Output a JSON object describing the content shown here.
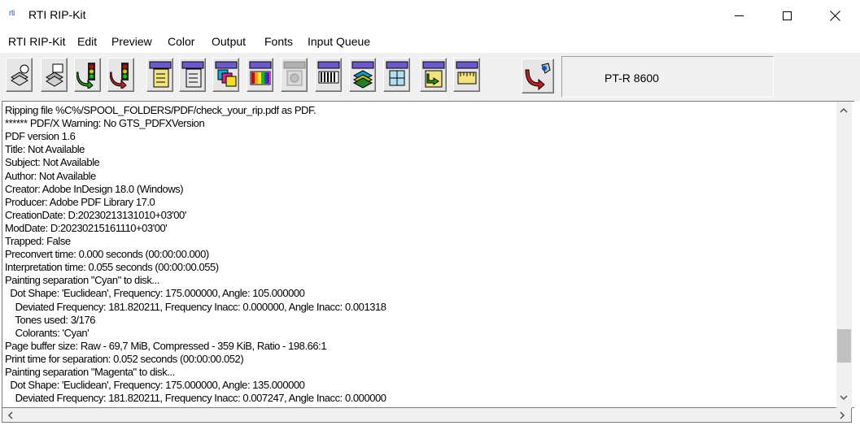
{
  "window": {
    "title": "RTI RIP-Kit",
    "icon_text": "rti",
    "icon_name": "rti-logo-icon"
  },
  "menu": {
    "items": [
      {
        "label": "RTI RIP-Kit"
      },
      {
        "label": "Edit"
      },
      {
        "label": "Preview"
      },
      {
        "label": "Color"
      },
      {
        "label": "Output"
      },
      {
        "label": "Fonts"
      },
      {
        "label": "Input Queue"
      }
    ]
  },
  "toolbar": {
    "buttons": [
      {
        "icon": "open-file-stack-icon"
      },
      {
        "icon": "print-stack-icon"
      },
      {
        "icon": "traffic-light-green-arrow-icon"
      },
      {
        "icon": "traffic-light-red-arrow-icon"
      },
      {
        "icon": "page-setup-icon"
      },
      {
        "icon": "document-settings-icon"
      },
      {
        "icon": "color-separation-icon"
      },
      {
        "icon": "color-calibration-icon"
      },
      {
        "icon": "disabled-tool-icon"
      },
      {
        "icon": "halftone-icon"
      },
      {
        "icon": "layers-icon"
      },
      {
        "icon": "grid-layout-icon"
      },
      {
        "icon": "output-queue-icon"
      },
      {
        "icon": "ruler-settings-icon"
      },
      {
        "icon": "device-connect-icon"
      }
    ],
    "device_model": "PT-R 8600"
  },
  "log": {
    "lines": [
      "Ripping file %C%/SPOOL_FOLDERS/PDF/check_your_rip.pdf as PDF.",
      "****** PDF/X Warning: No GTS_PDFXVersion",
      "PDF version 1.6",
      "Title: Not Available",
      "Subject: Not Available",
      "Author: Not Available",
      "Creator: Adobe InDesign 18.0 (Windows)",
      "Producer: Adobe PDF Library 17.0",
      "CreationDate: D:20230213131010+03'00'",
      "ModDate: D:20230215161110+03'00'",
      "Trapped: False",
      "Preconvert time: 0.000 seconds (00:00:00.000)",
      "Interpretation time: 0.055 seconds (00:00:00.055)",
      "Painting separation \"Cyan\" to disk...",
      "  Dot Shape: 'Euclidean', Frequency: 175.000000, Angle: 105.000000",
      "    Deviated Frequency: 181.820211, Frequency Inacc: 0.000000, Angle Inacc: 0.001318",
      "    Tones used: 3/176",
      "    Colorants: 'Cyan'",
      "Page buffer size: Raw - 69,7 MiB, Compressed - 359 KiB, Ratio - 198.66:1",
      "Print time for separation: 0.052 seconds (00:00:00.052)",
      "Painting separation \"Magenta\" to disk...",
      "  Dot Shape: 'Euclidean', Frequency: 175.000000, Angle: 135.000000",
      "    Deviated Frequency: 181.820211, Frequency Inacc: 0.007247, Angle Inacc: 0.000000"
    ]
  },
  "scrollbar": {
    "vertical_position": 0.88
  }
}
